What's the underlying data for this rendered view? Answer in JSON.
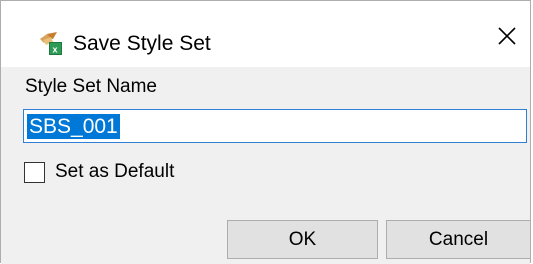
{
  "dialog": {
    "title": "Save Style Set",
    "icon": "style-set-app-icon",
    "close_icon": "close-icon"
  },
  "form": {
    "name_label": "Style Set Name",
    "name_value": "SBS_001",
    "default_checkbox_label": "Set as Default",
    "default_checked": false
  },
  "buttons": {
    "ok_label": "OK",
    "cancel_label": "Cancel"
  },
  "colors": {
    "selection": "#0078d7",
    "focus_border": "#2f7fd7",
    "button_face": "#e1e1e1",
    "dialog_bg": "#f0f0f0"
  }
}
